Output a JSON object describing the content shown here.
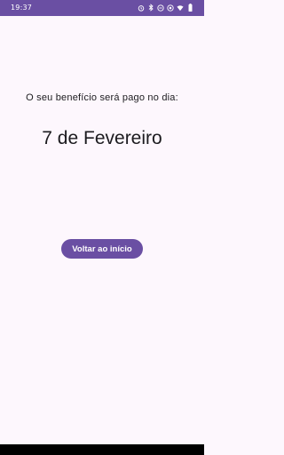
{
  "status_bar": {
    "time": "19:37",
    "icons": [
      "alarm-icon",
      "bluetooth-icon",
      "dnd-icon",
      "location-icon",
      "wifi-icon",
      "battery-icon"
    ]
  },
  "main": {
    "prompt": "O seu benefício será pago no dia:",
    "payment_date": "7 de Fevereiro",
    "back_button_label": "Voltar ao início"
  },
  "colors": {
    "accent": "#6a4fa3",
    "background": "#fdf7fd",
    "text": "#1c1b1f"
  }
}
